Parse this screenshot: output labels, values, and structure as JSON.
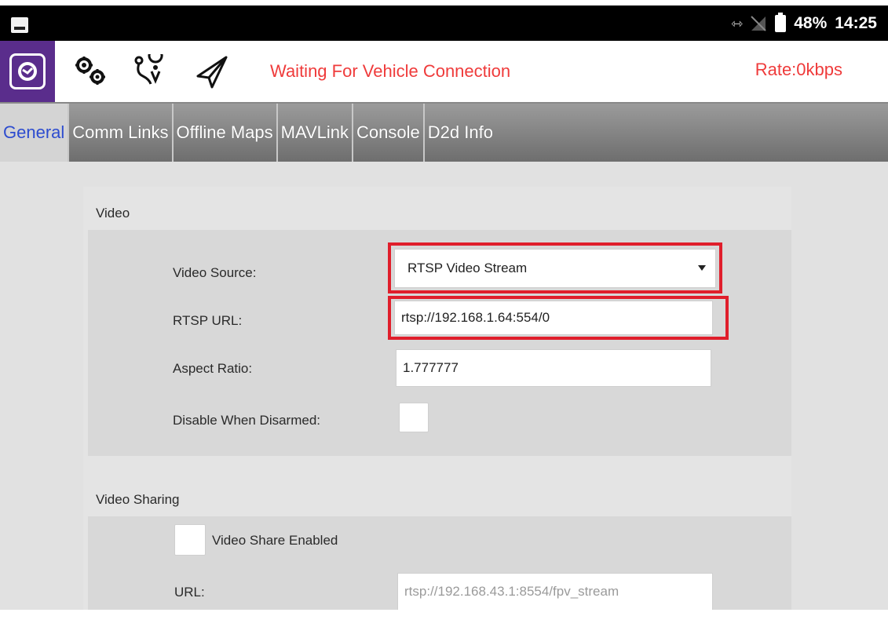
{
  "status_bar": {
    "battery_percent": "48%",
    "time": "14:25",
    "icons": [
      "image-notification-icon",
      "data-arrows-icon",
      "no-signal-icon",
      "battery-icon"
    ]
  },
  "toolbar": {
    "connection_status": "Waiting For Vehicle Connection",
    "rate": "Rate:0kbps",
    "status_color": "#ef3b3b",
    "icons": [
      "app-logo-icon",
      "settings-gears-icon",
      "plan-route-icon",
      "fly-paper-plane-icon"
    ]
  },
  "tabs": [
    {
      "label": "General",
      "active": true
    },
    {
      "label": "Comm Links",
      "active": false
    },
    {
      "label": "Offline Maps",
      "active": false
    },
    {
      "label": "MAVLink",
      "active": false
    },
    {
      "label": "Console",
      "active": false
    },
    {
      "label": "D2d Info",
      "active": false
    }
  ],
  "video": {
    "section_title": "Video",
    "source_label": "Video Source:",
    "source_value": "RTSP Video Stream",
    "rtsp_url_label": "RTSP URL:",
    "rtsp_url_value": "rtsp://192.168.1.64:554/0",
    "aspect_ratio_label": "Aspect Ratio:",
    "aspect_ratio_value": "1.777777",
    "disable_when_disarmed_label": "Disable When Disarmed:",
    "disable_when_disarmed_checked": false
  },
  "video_sharing": {
    "section_title": "Video Sharing",
    "share_enabled_label": "Video Share Enabled",
    "share_enabled_checked": false,
    "url_label": "URL:",
    "url_placeholder": "rtsp://192.168.43.1:8554/fpv_stream"
  },
  "highlight_color": "#e01e2b",
  "active_tab_color": "#2d4ccf"
}
